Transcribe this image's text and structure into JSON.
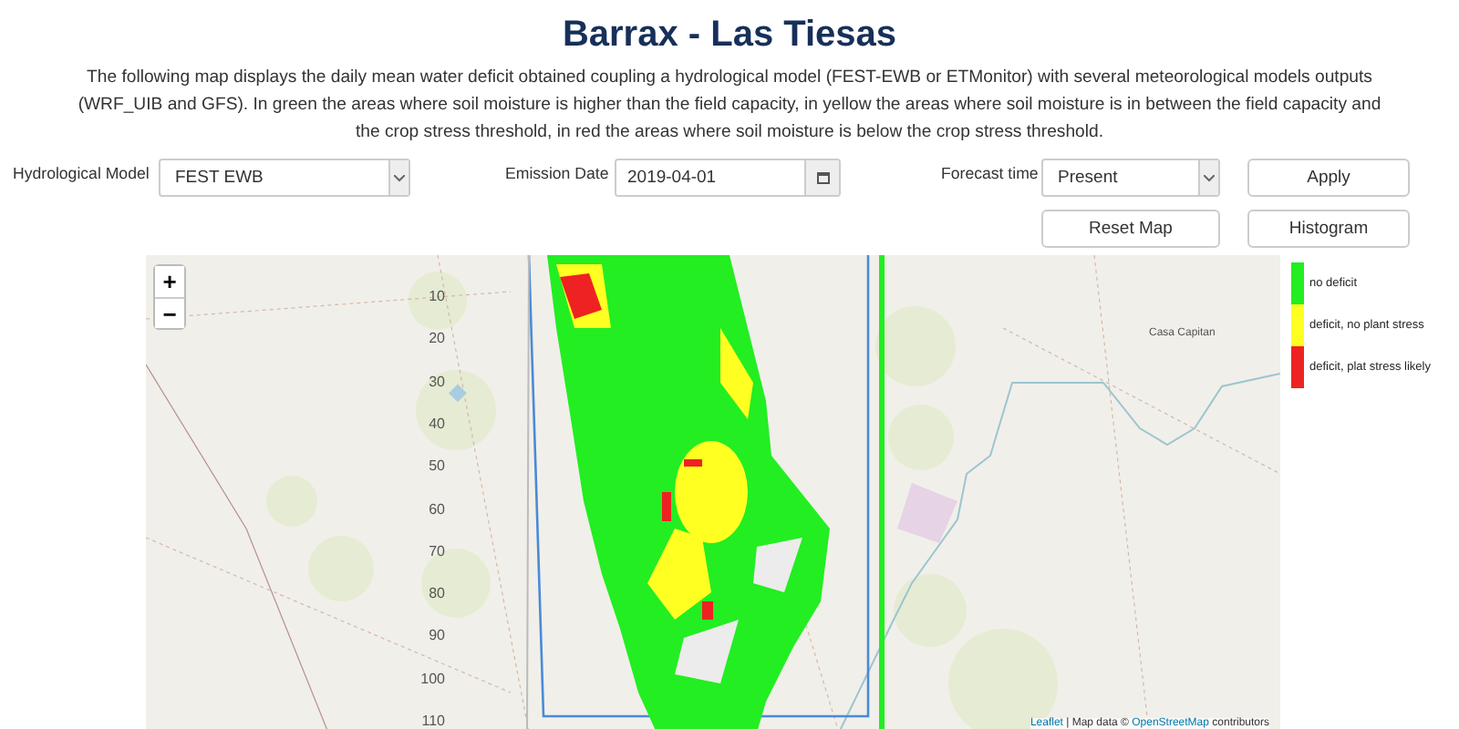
{
  "title": "Barrax - Las Tiesas",
  "description": "The following map displays the daily mean water deficit obtained coupling a hydrological model (FEST-EWB or ETMonitor) with several meteorological models outputs (WRF_UIB and GFS). In green the areas where soil moisture is higher than the field capacity, in yellow the areas where soil moisture is in between the field capacity and the crop stress threshold, in red the areas where soil moisture is below the crop stress threshold.",
  "controls": {
    "hydrological_model": {
      "label": "Hydrological Model",
      "value": "FEST EWB"
    },
    "emission_date": {
      "label": "Emission Date",
      "value": "2019-04-01"
    },
    "forecast_time": {
      "label": "Forecast time",
      "value": "Present"
    },
    "buttons": [
      "Apply",
      "Reset Map",
      "Histogram"
    ]
  },
  "map": {
    "zoom_buttons": [
      "+",
      "−"
    ],
    "axis_labels": [
      "10",
      "20",
      "30",
      "40",
      "50",
      "60",
      "70",
      "80",
      "90",
      "100",
      "110"
    ],
    "place_label": "Casa Capitan",
    "attribution": {
      "link": "Leaflet",
      "separator": " | Map data © ",
      "source_link": "OpenStreetMap",
      "suffix": " contributors"
    }
  },
  "legend": [
    {
      "label": "no deficit",
      "color": "#22ee22"
    },
    {
      "label": "deficit, no plant stress",
      "color": "#ffff22"
    },
    {
      "label": "deficit, plat stress likely",
      "color": "#ee2222"
    }
  ]
}
